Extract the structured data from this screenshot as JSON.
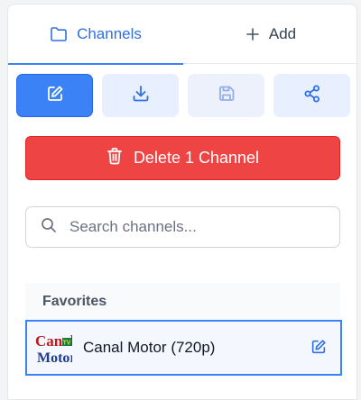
{
  "tabs": [
    {
      "label": "Channels",
      "icon": "folder-icon",
      "active": true
    },
    {
      "label": "Add",
      "icon": "plus-icon",
      "active": false
    }
  ],
  "toolbar": [
    {
      "icon": "edit-icon",
      "state": "active"
    },
    {
      "icon": "download-icon",
      "state": "normal"
    },
    {
      "icon": "save-icon",
      "state": "disabled"
    },
    {
      "icon": "share-icon",
      "state": "normal"
    }
  ],
  "delete_button": {
    "label": "Delete 1 Channel",
    "icon": "trash-icon"
  },
  "search": {
    "placeholder": "Search channels...",
    "value": ""
  },
  "favorites": {
    "title": "Favorites",
    "channels": [
      {
        "name": "Canal Motor (720p)",
        "logo": {
          "line1": "Canal",
          "line2": "Motor",
          "badge": "TV"
        },
        "selected": true
      }
    ]
  },
  "colors": {
    "accent": "#3b82f6",
    "danger": "#ef4444",
    "tool_bg": "#e8efff"
  }
}
